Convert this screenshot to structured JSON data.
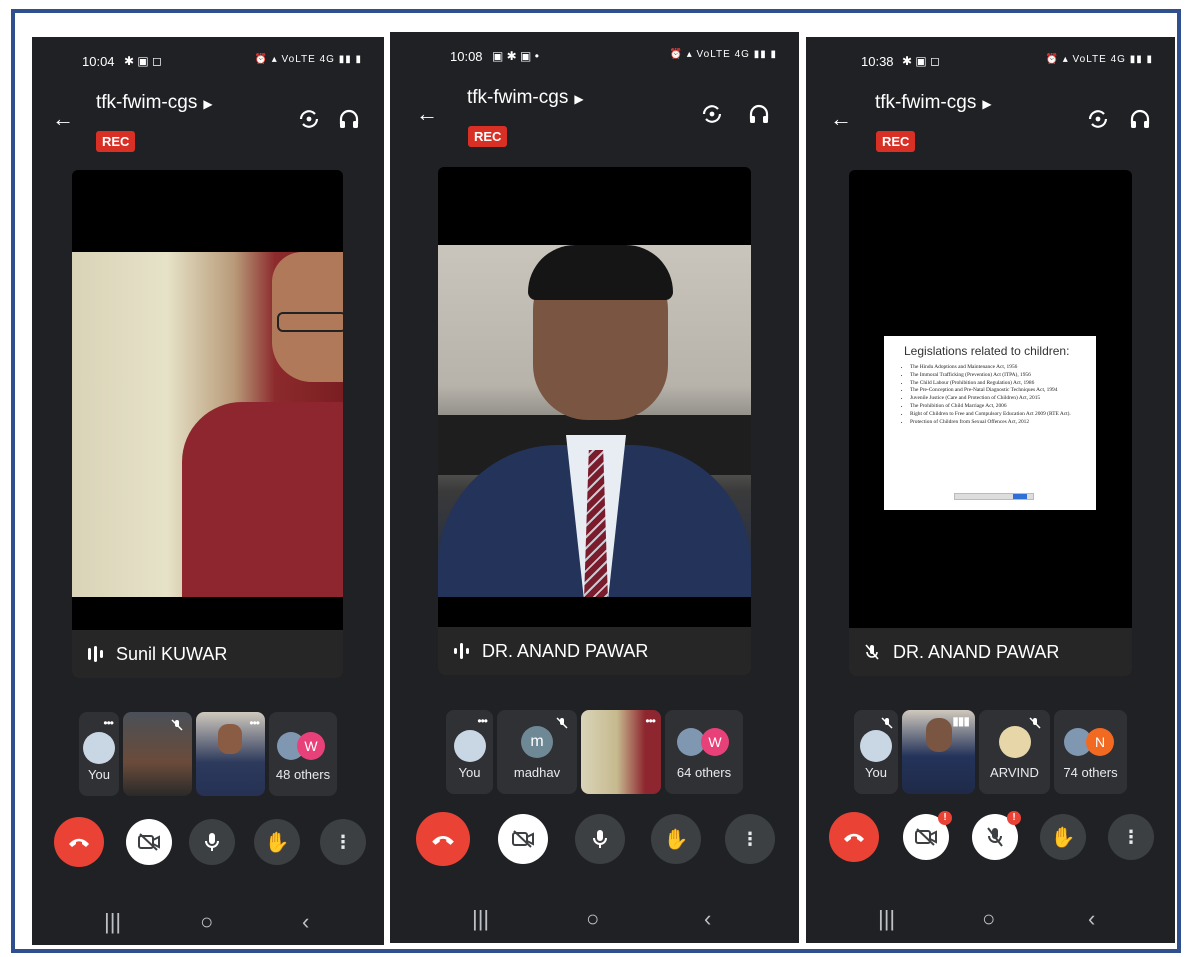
{
  "screens": [
    {
      "status_time": "10:04",
      "meeting_title": "tfk-fwim-cgs",
      "rec_label": "REC",
      "speaker_name": "Sunil KUWAR",
      "tiles": {
        "you": "You",
        "others": "48 others",
        "others_avatar_letter": "W"
      }
    },
    {
      "status_time": "10:08",
      "meeting_title": "tfk-fwim-cgs",
      "rec_label": "REC",
      "speaker_name": "DR. ANAND PAWAR",
      "tiles": {
        "you": "You",
        "p2_name": "madhav",
        "p2_avatar_letter": "m",
        "others": "64 others",
        "others_avatar_letter": "W"
      }
    },
    {
      "status_time": "10:38",
      "meeting_title": "tfk-fwim-cgs",
      "rec_label": "REC",
      "speaker_name": "DR. ANAND PAWAR",
      "tiles": {
        "you": "You",
        "p3_name": "ARVIND",
        "others": "74 others",
        "others_avatar_letter": "N"
      },
      "slide": {
        "title": "Legislations related to children:",
        "items": [
          "The Hindu Adoptions and Maintenance Act, 1956",
          "The Immoral Trafficking (Prevention) Act (ITPA), 1956",
          "The Child Labour (Prohibition and Regulation) Act, 1986",
          "The Pre-Conception and Pre-Natal Diagnostic Techniques Act, 1994",
          "Juvenile Justice (Care and Protection of Children) Act, 2015",
          "The Prohibition of Child Marriage Act, 2006",
          "Right of Children to Free and Compulsory Education Act 2009 (RTE Act).",
          "Protection of Children from Sexual Offences Act, 2012"
        ]
      }
    }
  ],
  "status_right": "VoLTE 4G",
  "colors": {
    "end_call": "#ea4335",
    "rec": "#d93025",
    "phone_bg": "#202124",
    "frame_border": "#2f4f8f"
  }
}
